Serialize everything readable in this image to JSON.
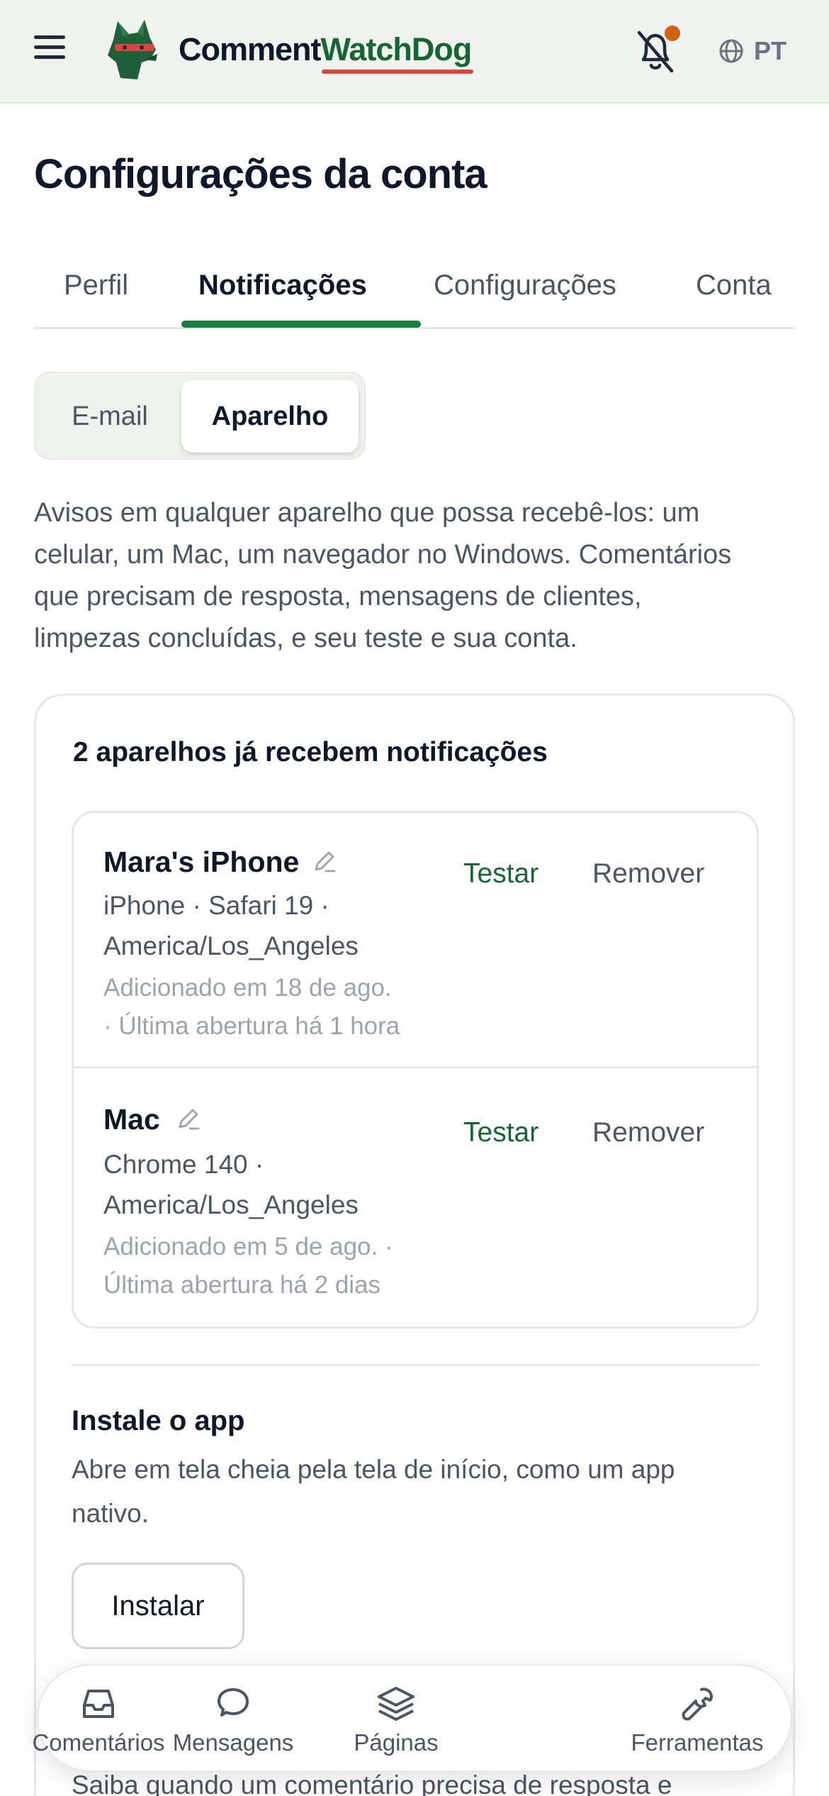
{
  "header": {
    "brand_part1": "Comment",
    "brand_part2": "WatchDog",
    "language": "PT",
    "colors": {
      "accent": "#166534",
      "underline": "#d9473e",
      "notification_dot": "#d35f12"
    }
  },
  "page": {
    "title": "Configurações da conta",
    "tabs": [
      {
        "label": "Perfil"
      },
      {
        "label": "Notificações",
        "active": true
      },
      {
        "label": "Configurações"
      },
      {
        "label": "Conta"
      }
    ]
  },
  "segmented": {
    "email": "E-mail",
    "device": "Aparelho",
    "selected": "Aparelho"
  },
  "intro_lines": [
    "Avisos em qualquer aparelho que possa recebê-los: um",
    "celular, um Mac, um navegador no Windows. Comentários",
    "que precisam de resposta, mensagens de clientes,",
    "limpezas concluídas, e seu teste e sua conta."
  ],
  "devices_card": {
    "title": "2 aparelhos já recebem notificações",
    "devices": [
      {
        "name": "Mara's iPhone",
        "meta_line1": "iPhone · Safari 19 ·",
        "meta_line2": "America/Los_Angeles",
        "sub_line1": "Adicionado em 18 de ago.",
        "sub_line2": "· Última abertura há 1 hora",
        "test_label": "Testar",
        "remove_label": "Remover"
      },
      {
        "name": "Mac",
        "meta_line1": "Chrome 140 ·",
        "meta_line2": "America/Los_Angeles",
        "sub_line1": "Adicionado em 5 de ago. ·",
        "sub_line2": "Última abertura há 2 dias",
        "test_label": "Testar",
        "remove_label": "Remover"
      }
    ]
  },
  "install": {
    "title": "Instale o app",
    "desc_line1": "Abre em tela cheia pela tela de início, como um app",
    "desc_line2": "nativo.",
    "button": "Instalar"
  },
  "next_section": {
    "desc": "Saiba quando um comentário precisa de resposta e"
  },
  "bottom_nav": [
    {
      "label": "Comentários",
      "icon": "inbox-icon"
    },
    {
      "label": "Mensagens",
      "icon": "chat-bubble-icon"
    },
    {
      "label": "Páginas",
      "icon": "layers-icon"
    },
    {
      "label": "Ferramentas",
      "icon": "wrench-icon"
    }
  ]
}
